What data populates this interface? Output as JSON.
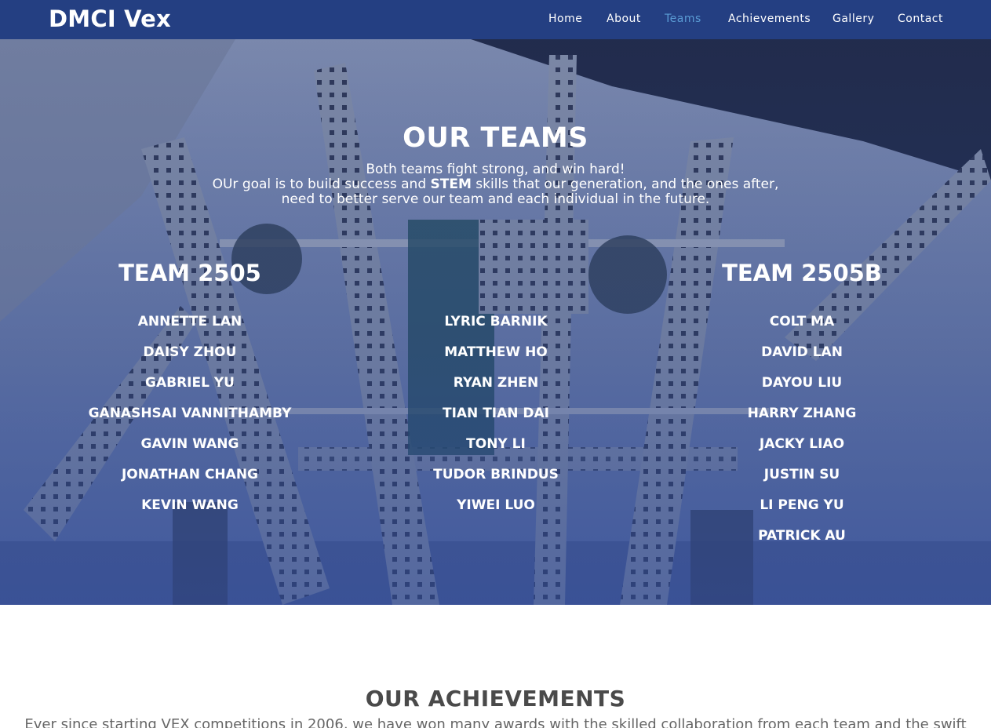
{
  "nav": {
    "brand": "DMCI Vex",
    "links": [
      {
        "label": "Home",
        "active": false
      },
      {
        "label": "About",
        "active": false
      },
      {
        "label": "Teams",
        "active": true
      },
      {
        "label": "Achievements",
        "active": false
      },
      {
        "label": "Gallery",
        "active": false
      },
      {
        "label": "Contact",
        "active": false
      }
    ]
  },
  "teams_section": {
    "title": "OUR TEAMS",
    "subtitle_line1": "Both teams fight strong, and win hard!",
    "subtitle_line2_pre": "OUr goal is to build success and ",
    "subtitle_line2_bold": "STEM",
    "subtitle_line2_post": " skills that our generation, and the ones after,",
    "subtitle_line3": "need to better serve our team and each individual in the future.",
    "team_a": {
      "title": "TEAM 2505",
      "members": [
        "ANNETTE LAN",
        "DAISY ZHOU",
        "GABRIEL YU",
        "GANASHSAI VANNITHAMBY",
        "GAVIN WANG",
        "JONATHAN CHANG",
        "KEVIN WANG"
      ]
    },
    "middle": {
      "members": [
        "LYRIC BARNIK",
        "MATTHEW HO",
        "RYAN ZHEN",
        "TIAN TIAN DAI",
        "TONY LI",
        "TUDOR BRINDUS",
        "YIWEI LUO"
      ]
    },
    "team_b": {
      "title": "TEAM 2505B",
      "members": [
        "COLT MA",
        "DAVID LAN",
        "DAYOU LIU",
        "HARRY ZHANG",
        "JACKY LIAO",
        "JUSTIN SU",
        "LI PENG YU",
        "PATRICK AU"
      ]
    }
  },
  "achievements_section": {
    "title": "OUR ACHIEVEMENTS",
    "text": "Ever since starting VEX competitions in 2006, we have won many awards with the skilled collaboration from each team and the swift"
  },
  "colors": {
    "navbar": "#243f82",
    "active_link": "#5a9bd4",
    "hero_tint": "#3c5597"
  }
}
